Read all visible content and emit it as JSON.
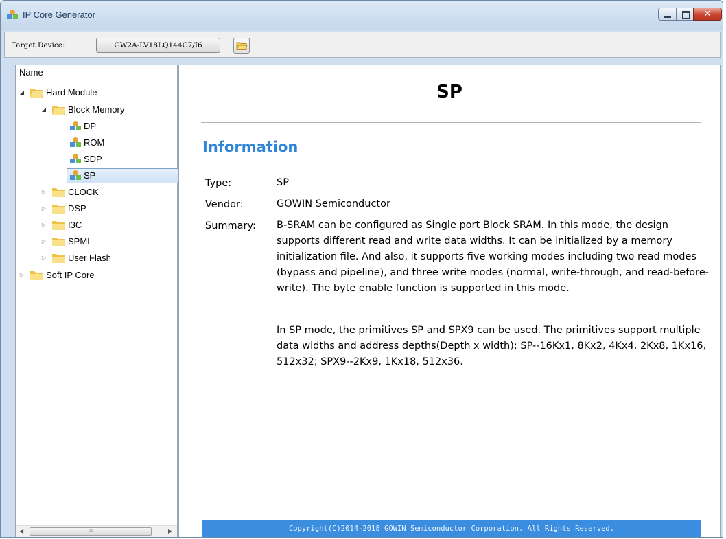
{
  "window": {
    "title": "IP Core Generator"
  },
  "toolbar": {
    "target_label": "Target Device:",
    "device_value": "GW2A-LV18LQ144C7/I6",
    "open_icon": "folder-open-icon"
  },
  "tree": {
    "header": "Name",
    "items": [
      {
        "label": "Hard Module",
        "level": 0,
        "expanded": true,
        "icon": "folder-icon"
      },
      {
        "label": "Block Memory",
        "level": 1,
        "expanded": true,
        "icon": "folder-icon"
      },
      {
        "label": "DP",
        "level": 2,
        "icon": "ip-core-icon"
      },
      {
        "label": "ROM",
        "level": 2,
        "icon": "ip-core-icon"
      },
      {
        "label": "SDP",
        "level": 2,
        "icon": "ip-core-icon"
      },
      {
        "label": "SP",
        "level": 2,
        "icon": "ip-core-icon",
        "selected": true
      },
      {
        "label": "CLOCK",
        "level": 1,
        "expanded": false,
        "icon": "folder-icon"
      },
      {
        "label": "DSP",
        "level": 1,
        "expanded": false,
        "icon": "folder-icon"
      },
      {
        "label": "I3C",
        "level": 1,
        "expanded": false,
        "icon": "folder-icon"
      },
      {
        "label": "SPMI",
        "level": 1,
        "expanded": false,
        "icon": "folder-icon"
      },
      {
        "label": "User Flash",
        "level": 1,
        "expanded": false,
        "icon": "folder-icon"
      },
      {
        "label": "Soft IP Core",
        "level": 0,
        "expanded": false,
        "icon": "folder-icon"
      }
    ],
    "scrollbar_grip": "III"
  },
  "doc": {
    "title": "SP",
    "section_heading": "Information",
    "type_label": "Type:",
    "type_value": "SP",
    "vendor_label": "Vendor:",
    "vendor_value": "GOWIN Semiconductor",
    "summary_label": "Summary:",
    "summary_p1": "B-SRAM can be configured as Single port Block SRAM. In this mode, the design supports different read and write data widths. It can be initialized by a memory initialization file. And also, it supports five working modes including two read modes (bypass and pipeline), and three write modes (normal, write-through, and read-before-write). The byte enable function is supported in this mode.",
    "summary_p2": "In SP mode, the primitives SP and SPX9 can be used. The primitives support multiple data widths and address depths(Depth x width): SP--16Kx1, 8Kx2, 4Kx4, 2Kx8, 1Kx16, 512x32; SPX9--2Kx9, 1Kx18, 512x36.",
    "footer": "Copyright(C)2014-2018 GOWIN Semiconductor Corporation. All Rights Reserved."
  },
  "colors": {
    "heading_blue": "#2f86d9",
    "footer_blue": "#3b8de0",
    "selection_bg": "#cfe2f7"
  }
}
